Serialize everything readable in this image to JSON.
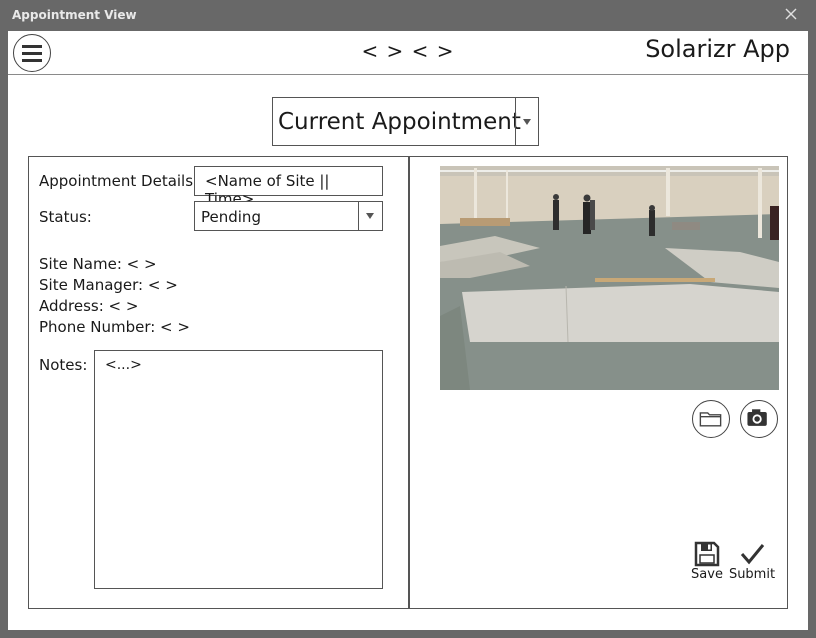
{
  "window": {
    "title": "Appointment View"
  },
  "header": {
    "center_text": "< > < >",
    "app_title": "Solarizr App"
  },
  "appointment_select": {
    "value": "Current Appointment"
  },
  "details": {
    "appointment_details_label": "Appointment Details",
    "appointment_details_value": "<Name of Site || Time>",
    "status_label": "Status:",
    "status_value": "Pending",
    "site_name": "Site Name: < >",
    "site_manager": "Site Manager: < >",
    "address": "Address: < >",
    "phone_number": "Phone Number: < >",
    "notes_label": "Notes:",
    "notes_value": "<...>"
  },
  "actions": {
    "save_label": "Save",
    "submit_label": "Submit"
  },
  "icons": {
    "menu": "hamburger-menu-icon",
    "close": "close-icon",
    "folder": "folder-icon",
    "camera": "camera-icon",
    "save": "floppy-disk-icon",
    "submit": "checkmark-icon"
  }
}
